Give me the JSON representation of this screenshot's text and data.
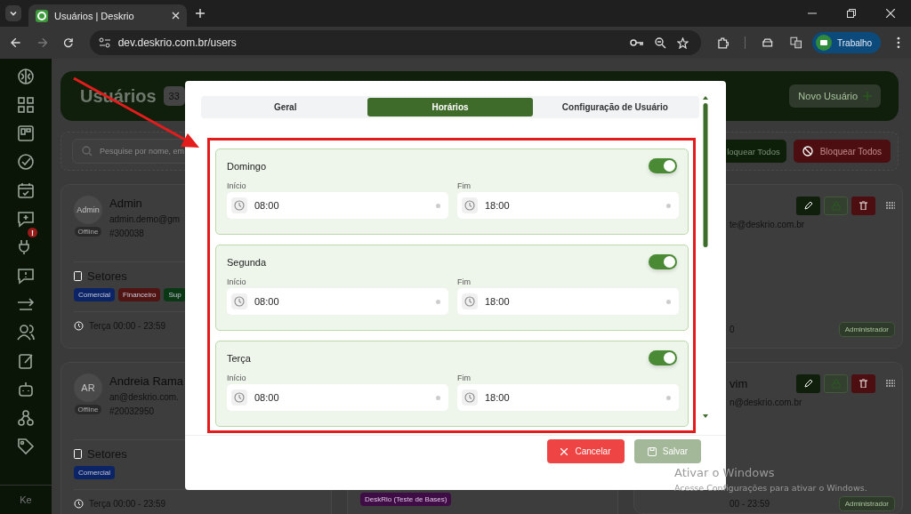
{
  "browser": {
    "tab_title": "Usuários | Deskrio",
    "url": "dev.deskrio.com.br/users",
    "profile": "Trabalho"
  },
  "sidebar": {
    "badge": "!",
    "user_initials": "Ke"
  },
  "header": {
    "title": "Usuários",
    "count": "33",
    "new_button": "Novo Usuário"
  },
  "toolbar": {
    "search_placeholder": "Pesquise por nome, em",
    "unblock_all": "loquear Todos",
    "block_all": "Bloquear Todos"
  },
  "cards_left": [
    {
      "avatar": "Admin",
      "status": "Offline",
      "name": "Admin",
      "email": "admin.demo@gm",
      "id": "#300038",
      "sectors_label": "Setores",
      "tags": [
        {
          "label": "Comercial",
          "color": "#0b2466"
        },
        {
          "label": "Financeiro",
          "color": "#501512"
        },
        {
          "label": "Sup",
          "color": "#0a3815"
        }
      ],
      "schedule": "Terça 00:00 - 23:59"
    },
    {
      "avatar": "AR",
      "status": "Offline",
      "name": "Andreia Rama",
      "email": "an@deskrio.com.",
      "id": "#20032950",
      "sectors_label": "Setores",
      "tags": [
        {
          "label": "Comercial",
          "color": "#0b2466"
        }
      ],
      "schedule": "Terça 00:00 - 23:59"
    }
  ],
  "card_middle": {
    "tag": {
      "label": "DeskRio (Teste de Bases)",
      "color": "#3e0d45"
    }
  },
  "cards_right": [
    {
      "email": "te@deskrio.com.br",
      "schedule": "0",
      "role": "Administrador"
    },
    {
      "name": "vim",
      "email": "n@deskrio.com.br",
      "schedule": "00 - 23:59",
      "role": "Administrador"
    }
  ],
  "modal": {
    "tabs": [
      {
        "label": "Geral",
        "selected": false
      },
      {
        "label": "Horários",
        "selected": true
      },
      {
        "label": "Configuração de Usuário",
        "selected": false
      }
    ],
    "days": [
      {
        "name": "Domingo",
        "enabled": true,
        "start_label": "Início",
        "start": "08:00",
        "end_label": "Fim",
        "end": "18:00"
      },
      {
        "name": "Segunda",
        "enabled": true,
        "start_label": "Início",
        "start": "08:00",
        "end_label": "Fim",
        "end": "18:00"
      },
      {
        "name": "Terça",
        "enabled": true,
        "start_label": "Início",
        "start": "08:00",
        "end_label": "Fim",
        "end": "18:00"
      }
    ],
    "cancel": "Cancelar",
    "save": {
      "label": "Salvar",
      "disabled": true
    }
  },
  "os_notice": {
    "title": "Ativar o Windows",
    "text": "Acesse Configurações para ativar o Windows."
  }
}
